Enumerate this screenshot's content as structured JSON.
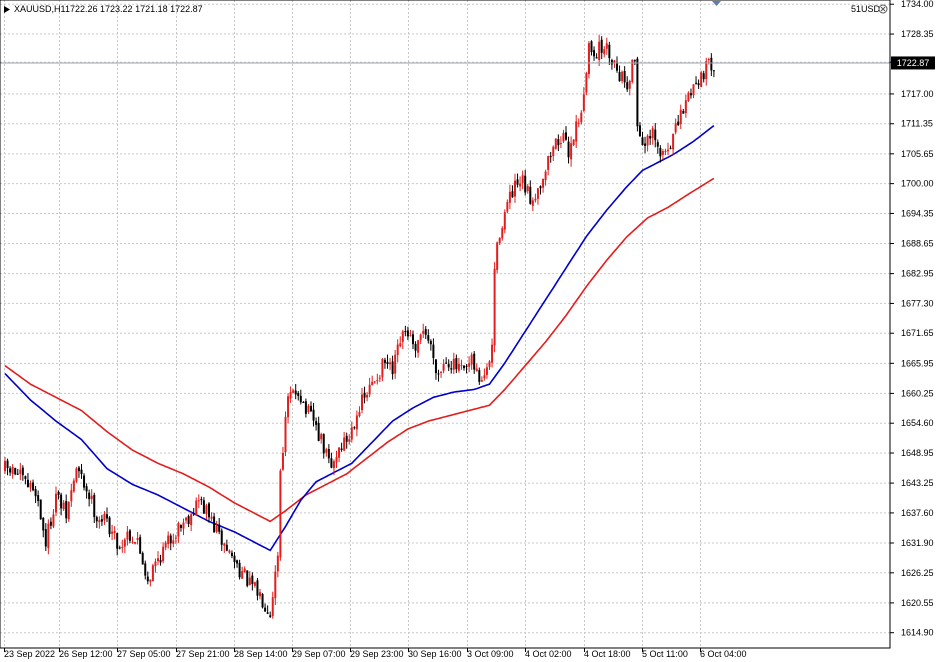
{
  "header": {
    "symbol": "XAUUSD,H1",
    "ohlc": "1722.26 1723.22 1721.18 1722.87",
    "account": "51USD"
  },
  "colors": {
    "up_candle": "#e31d1d",
    "down_candle": "#000000",
    "ma_fast": "#0000cc",
    "ma_slow": "#e31d1d",
    "grid": "#c8c8c8",
    "price_line": "#9aa4b0",
    "price_tag_bg": "#000000",
    "nav_marker": "#5b7fb5"
  },
  "chart_data": {
    "type": "candlestick",
    "title": "XAUUSD,H1",
    "ylim": [
      1612.0,
      1734.8
    ],
    "y_ticks": [
      "1734.00",
      "1728.35",
      "1723.00",
      "1717.00",
      "1711.35",
      "1705.65",
      "1700.00",
      "1694.35",
      "1688.65",
      "1682.95",
      "1677.30",
      "1671.65",
      "1665.95",
      "1660.25",
      "1654.60",
      "1648.95",
      "1643.25",
      "1637.60",
      "1631.90",
      "1626.25",
      "1620.55",
      "1614.90"
    ],
    "x_ticks": [
      "23 Sep 2022",
      "26 Sep 12:00",
      "27 Sep 05:00",
      "27 Sep 21:00",
      "28 Sep 14:00",
      "29 Sep 07:00",
      "29 Sep 23:00",
      "30 Sep 16:00",
      "3 Oct 09:00",
      "4 Oct 02:00",
      "4 Oct 18:00",
      "5 Oct 11:00",
      "6 Oct 04:00"
    ],
    "current_price": "1722.87",
    "close_anchors": [
      [
        0,
        1646.0
      ],
      [
        5,
        1645.0
      ],
      [
        8,
        1643.0
      ],
      [
        12,
        1642.0
      ],
      [
        16,
        1632.0
      ],
      [
        20,
        1641.0
      ],
      [
        24,
        1637.0
      ],
      [
        28,
        1646.0
      ],
      [
        33,
        1641.0
      ],
      [
        36,
        1637.0
      ],
      [
        40,
        1636.0
      ],
      [
        45,
        1631.0
      ],
      [
        48,
        1634.0
      ],
      [
        52,
        1632.0
      ],
      [
        56,
        1625.0
      ],
      [
        60,
        1629.0
      ],
      [
        64,
        1632.0
      ],
      [
        68,
        1635.0
      ],
      [
        72,
        1637.0
      ],
      [
        76,
        1640.0
      ],
      [
        80,
        1637.0
      ],
      [
        84,
        1633.0
      ],
      [
        88,
        1630.0
      ],
      [
        92,
        1627.0
      ],
      [
        96,
        1624.0
      ],
      [
        100,
        1622.0
      ],
      [
        104,
        1619.0
      ],
      [
        107,
        1630.0
      ],
      [
        108,
        1646.0
      ],
      [
        111,
        1659.0
      ],
      [
        115,
        1661.0
      ],
      [
        118,
        1657.0
      ],
      [
        121,
        1655.0
      ],
      [
        124,
        1651.0
      ],
      [
        128,
        1646.0
      ],
      [
        131,
        1650.0
      ],
      [
        135,
        1652.0
      ],
      [
        138,
        1657.0
      ],
      [
        142,
        1660.0
      ],
      [
        145,
        1663.0
      ],
      [
        149,
        1666.0
      ],
      [
        152,
        1664.0
      ],
      [
        155,
        1670.0
      ],
      [
        158,
        1672.0
      ],
      [
        161,
        1667.0
      ],
      [
        164,
        1673.0
      ],
      [
        167,
        1669.0
      ],
      [
        170,
        1664.0
      ],
      [
        173,
        1667.0
      ],
      [
        177,
        1665.0
      ],
      [
        180,
        1664.0
      ],
      [
        183,
        1666.0
      ],
      [
        186,
        1663.0
      ],
      [
        189,
        1664.0
      ],
      [
        191,
        1669.0
      ],
      [
        192,
        1684.0
      ],
      [
        194,
        1691.0
      ],
      [
        197,
        1696.0
      ],
      [
        200,
        1699.0
      ],
      [
        203,
        1700.0
      ],
      [
        206,
        1697.0
      ],
      [
        209,
        1699.0
      ],
      [
        212,
        1703.0
      ],
      [
        215,
        1707.0
      ],
      [
        218,
        1709.0
      ],
      [
        221,
        1706.0
      ],
      [
        224,
        1711.0
      ],
      [
        227,
        1716.0
      ],
      [
        229,
        1726.0
      ],
      [
        232,
        1725.0
      ],
      [
        235,
        1726.0
      ],
      [
        238,
        1724.0
      ],
      [
        241,
        1721.0
      ],
      [
        244,
        1719.0
      ],
      [
        247,
        1724.0
      ],
      [
        248,
        1711.0
      ],
      [
        251,
        1707.0
      ],
      [
        254,
        1709.0
      ],
      [
        257,
        1705.0
      ],
      [
        260,
        1707.0
      ],
      [
        263,
        1710.0
      ],
      [
        266,
        1714.0
      ],
      [
        269,
        1718.0
      ],
      [
        272,
        1720.0
      ],
      [
        275,
        1722.0
      ],
      [
        278,
        1722.9
      ]
    ],
    "ma_fast_anchors": [
      [
        0,
        1664.0
      ],
      [
        10,
        1659.0
      ],
      [
        20,
        1655.0
      ],
      [
        30,
        1651.5
      ],
      [
        40,
        1646.0
      ],
      [
        50,
        1643.0
      ],
      [
        60,
        1641.0
      ],
      [
        70,
        1638.5
      ],
      [
        80,
        1636.0
      ],
      [
        90,
        1634.0
      ],
      [
        98,
        1632.0
      ],
      [
        104,
        1630.5
      ],
      [
        110,
        1635.0
      ],
      [
        116,
        1640.0
      ],
      [
        122,
        1643.5
      ],
      [
        128,
        1645.0
      ],
      [
        136,
        1647.0
      ],
      [
        144,
        1651.0
      ],
      [
        152,
        1655.0
      ],
      [
        160,
        1657.5
      ],
      [
        168,
        1659.5
      ],
      [
        176,
        1660.5
      ],
      [
        184,
        1661.0
      ],
      [
        190,
        1662.0
      ],
      [
        196,
        1666.0
      ],
      [
        204,
        1672.0
      ],
      [
        212,
        1678.0
      ],
      [
        220,
        1684.0
      ],
      [
        228,
        1690.0
      ],
      [
        236,
        1695.0
      ],
      [
        244,
        1699.5
      ],
      [
        250,
        1702.5
      ],
      [
        256,
        1704.0
      ],
      [
        262,
        1705.5
      ],
      [
        270,
        1708.0
      ],
      [
        278,
        1711.0
      ]
    ],
    "ma_slow_anchors": [
      [
        0,
        1665.5
      ],
      [
        10,
        1662.0
      ],
      [
        20,
        1659.5
      ],
      [
        30,
        1657.0
      ],
      [
        40,
        1653.0
      ],
      [
        50,
        1649.5
      ],
      [
        60,
        1647.0
      ],
      [
        70,
        1645.0
      ],
      [
        80,
        1642.5
      ],
      [
        90,
        1639.5
      ],
      [
        98,
        1637.5
      ],
      [
        104,
        1636.0
      ],
      [
        110,
        1638.0
      ],
      [
        118,
        1641.0
      ],
      [
        126,
        1643.0
      ],
      [
        134,
        1645.0
      ],
      [
        142,
        1648.0
      ],
      [
        150,
        1651.0
      ],
      [
        158,
        1653.5
      ],
      [
        166,
        1655.0
      ],
      [
        174,
        1656.0
      ],
      [
        182,
        1657.0
      ],
      [
        190,
        1658.0
      ],
      [
        196,
        1661.0
      ],
      [
        204,
        1665.5
      ],
      [
        212,
        1670.0
      ],
      [
        220,
        1675.0
      ],
      [
        228,
        1680.5
      ],
      [
        236,
        1685.5
      ],
      [
        244,
        1690.0
      ],
      [
        252,
        1693.5
      ],
      [
        260,
        1695.5
      ],
      [
        268,
        1698.0
      ],
      [
        278,
        1701.0
      ]
    ]
  }
}
